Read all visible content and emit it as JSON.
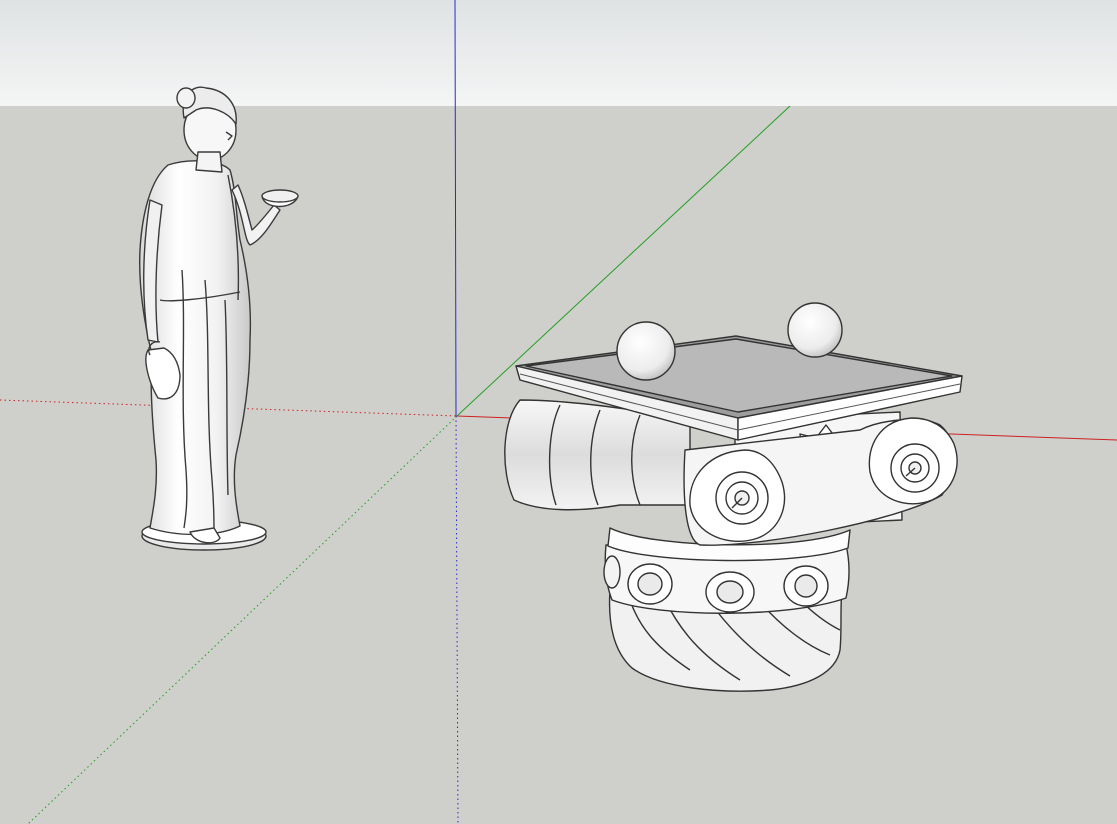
{
  "app": {
    "scene": {
      "sky_color_top": "#dfe2e3",
      "sky_color_bottom": "#f4f5f5",
      "ground_color": "#cfcfcb",
      "axis_colors": {
        "red": "#cc2222",
        "green": "#22a022",
        "blue": "#2a2ad0"
      },
      "models": [
        {
          "name": "statue-of-hebe",
          "icon": "statue-icon"
        },
        {
          "name": "ionic-column-capital",
          "icon": "column-capital-icon"
        }
      ]
    }
  }
}
